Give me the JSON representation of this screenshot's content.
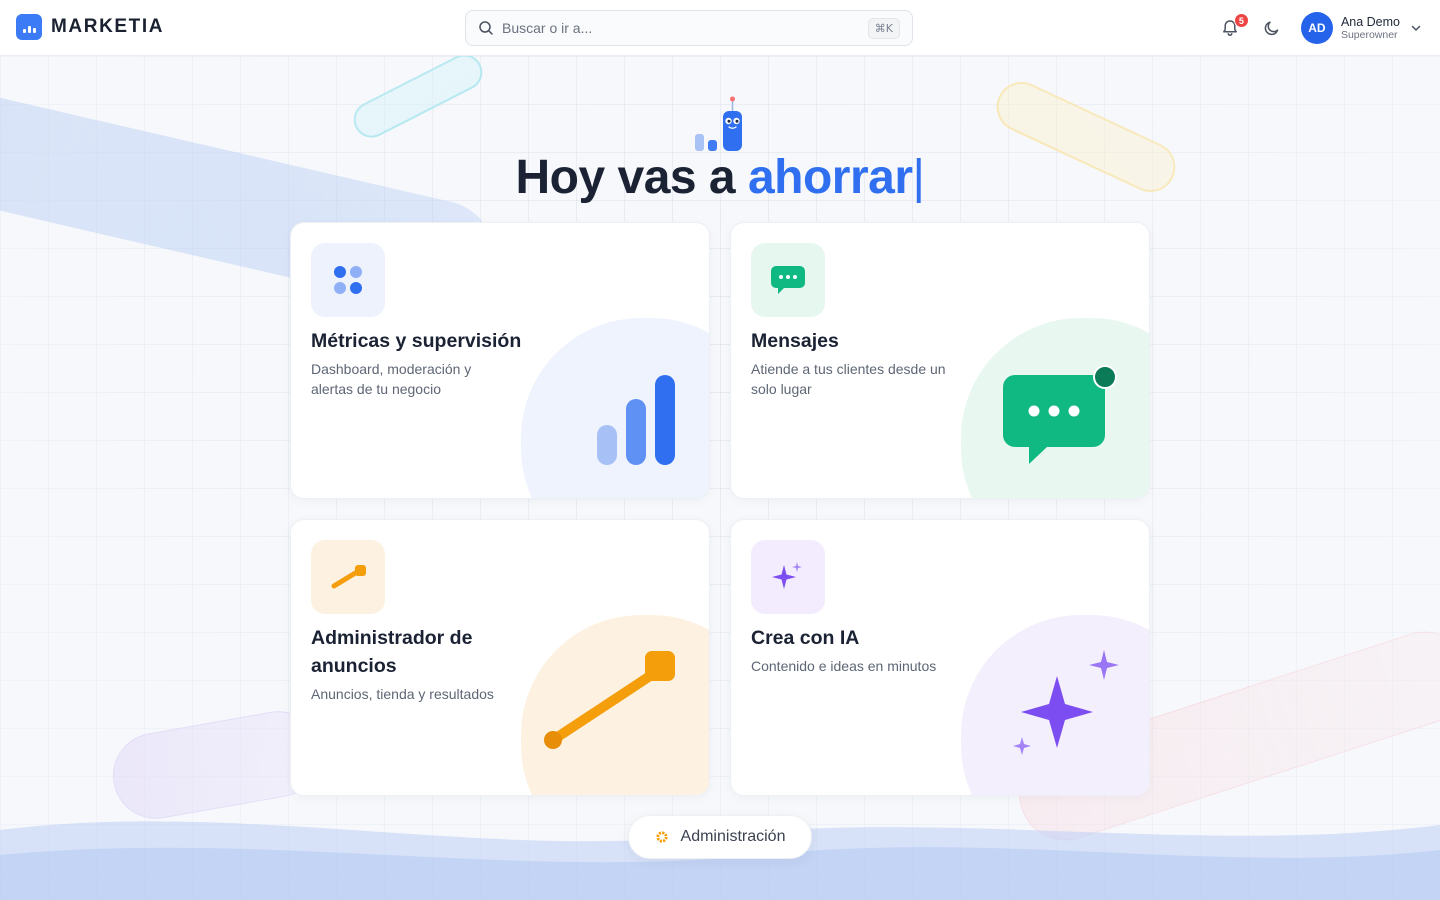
{
  "brand": {
    "name": "MARKETIA",
    "logo_icon": "bar-chart-logo-icon",
    "color": "#3b7bf5"
  },
  "search": {
    "placeholder": "Buscar o ir a...",
    "shortcut": "⌘K",
    "icon": "search-icon"
  },
  "notifications": {
    "count": "5",
    "icon": "bell-icon"
  },
  "theme_toggle": {
    "icon": "moon-icon"
  },
  "user": {
    "initials": "AD",
    "name": "Ana Demo",
    "role": "Superowner",
    "menu_icon": "chevron-down-icon"
  },
  "hero": {
    "prefix": "Hoy vas a",
    "accent": "ahorrar",
    "caret": "|",
    "mascot_icon": "robot-mascot-icon"
  },
  "cards": [
    {
      "title": "Métricas y supervisión",
      "description": "Dashboard, moderación y alertas de tu negocio",
      "icon": "grid-dots-icon",
      "accent": "#3b7bf5"
    },
    {
      "title": "Mensajes",
      "description": "Atiende a tus clientes desde un solo lugar",
      "icon": "chat-bubble-icon",
      "accent": "#10b981"
    },
    {
      "title": "Administrador de anuncios",
      "description": "Anuncios, tienda y resultados",
      "icon": "megaphone-icon",
      "accent": "#f59e0b"
    },
    {
      "title": "Crea con IA",
      "description": "Contenido e ideas en minutos",
      "icon": "sparkles-icon",
      "accent": "#7c4df0"
    }
  ],
  "admin": {
    "label": "Administración",
    "icon": "gear-icon"
  }
}
